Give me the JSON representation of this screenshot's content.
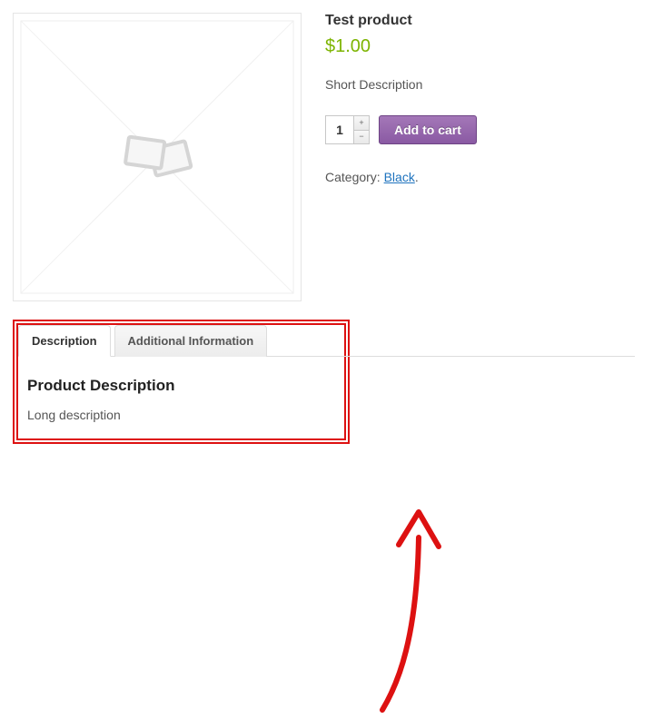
{
  "product": {
    "title": "Test product",
    "price": "$1.00",
    "short_description": "Short Description",
    "quantity": "1",
    "add_to_cart_label": "Add to cart",
    "category_label": "Category: ",
    "category_link": "Black",
    "category_suffix": "."
  },
  "tabs": {
    "description_label": "Description",
    "additional_label": "Additional Information",
    "panel_heading": "Product Description",
    "panel_content": "Long description"
  }
}
